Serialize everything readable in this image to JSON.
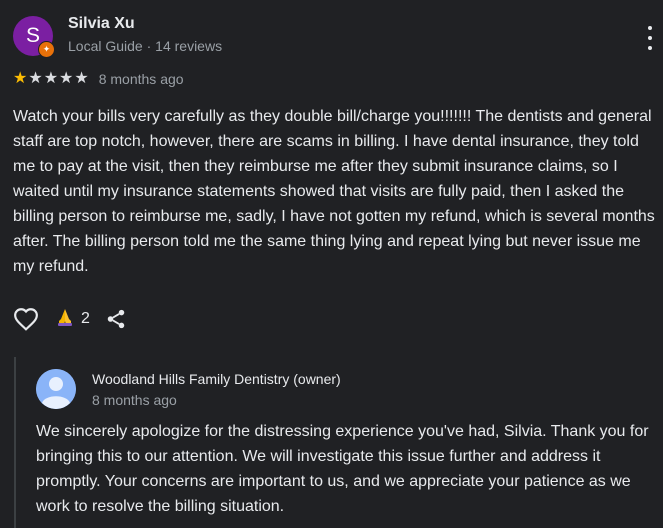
{
  "review": {
    "author": {
      "initial": "S",
      "name": "Silvia Xu",
      "meta": "Local Guide · 14 reviews",
      "avatar_color": "#7b1fa2",
      "badge_icon": "local-guide-star-icon"
    },
    "rating": 1,
    "max_rating": 5,
    "time": "8 months ago",
    "text": "Watch your bills very carefully as they double bill/charge you!!!!!!! The dentists and general staff are top notch, however, there are scams in billing. I have dental insurance, they told me to pay at the visit, then they reimburse me after they submit insurance claims, so I waited until my insurance statements showed that visits are fully paid, then I asked the billing person to reimburse me, sadly, I have not gotten my refund, which is several months after. The billing person told me the same thing lying and repeat lying but never issue me my refund.",
    "actions": {
      "like_icon": "heart-outline-icon",
      "reaction_icon": "folded-hands-emoji-icon",
      "reaction_count": "2",
      "share_icon": "share-icon"
    }
  },
  "owner_reply": {
    "name": "Woodland Hills Family Dentistry (owner)",
    "time": "8 months ago",
    "avatar_icon": "default-profile-avatar-icon",
    "text": "We sincerely apologize for the distressing experience you've had, Silvia. Thank you for bringing this to our attention. We will investigate this issue further and address it promptly. Your concerns are important to us, and we appreciate your patience as we work to resolve the billing situation."
  },
  "colors": {
    "background": "#202124",
    "text": "#e8eaed",
    "secondary_text": "#9aa0a6",
    "star": "#fbbc04"
  }
}
